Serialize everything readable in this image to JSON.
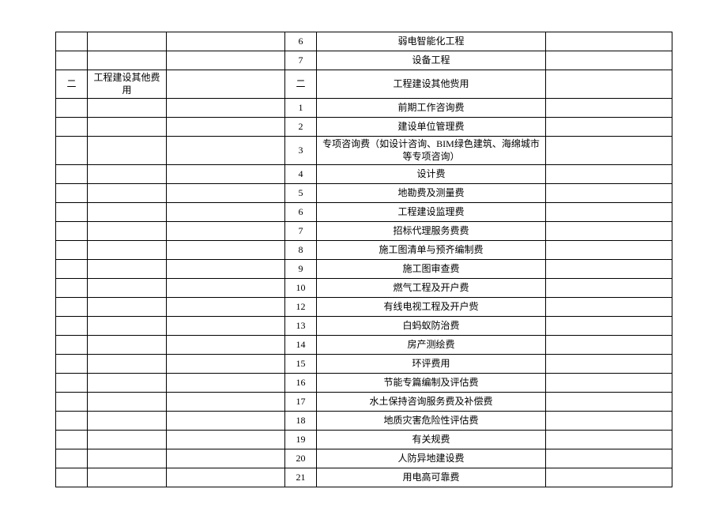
{
  "rows": [
    {
      "a": "",
      "b": "",
      "c": "",
      "d": "6",
      "e": "弱电智能化工程",
      "f": ""
    },
    {
      "a": "",
      "b": "",
      "c": "",
      "d": "7",
      "e": "设备工程",
      "f": ""
    },
    {
      "a": "二",
      "b": "工程建设其他费用",
      "c": "",
      "d": "二",
      "e": "工程建设其他赀用",
      "f": ""
    },
    {
      "a": "",
      "b": "",
      "c": "",
      "d": "1",
      "e": "前期工作咨询费",
      "f": ""
    },
    {
      "a": "",
      "b": "",
      "c": "",
      "d": "2",
      "e": "建设单位管理费",
      "f": ""
    },
    {
      "a": "",
      "b": "",
      "c": "",
      "d": "3",
      "e": "专项咨询费（如设计咨询、BIM绿色建筑、海绵城市等专项咨询）",
      "f": "",
      "tall": true
    },
    {
      "a": "",
      "b": "",
      "c": "",
      "d": "4",
      "e": "设计费",
      "f": ""
    },
    {
      "a": "",
      "b": "",
      "c": "",
      "d": "5",
      "e": "地勘费及测量费",
      "f": ""
    },
    {
      "a": "",
      "b": "",
      "c": "",
      "d": "6",
      "e": "工程建设监理费",
      "f": ""
    },
    {
      "a": "",
      "b": "",
      "c": "",
      "d": "7",
      "e": "招标代理服务费费",
      "f": ""
    },
    {
      "a": "",
      "b": "",
      "c": "",
      "d": "8",
      "e": "施工图清单与预齐编制费",
      "f": ""
    },
    {
      "a": "",
      "b": "",
      "c": "",
      "d": "9",
      "e": "施工图审查费",
      "f": ""
    },
    {
      "a": "",
      "b": "",
      "c": "",
      "d": "10",
      "e": "燃气工程及开户费",
      "f": ""
    },
    {
      "a": "",
      "b": "",
      "c": "",
      "d": "12",
      "e": "有线电视工程及开户赀",
      "f": ""
    },
    {
      "a": "",
      "b": "",
      "c": "",
      "d": "13",
      "e": "白蚂蚁防治费",
      "f": ""
    },
    {
      "a": "",
      "b": "",
      "c": "",
      "d": "14",
      "e": "房产测绘费",
      "f": ""
    },
    {
      "a": "",
      "b": "",
      "c": "",
      "d": "15",
      "e": "环评费用",
      "f": ""
    },
    {
      "a": "",
      "b": "",
      "c": "",
      "d": "16",
      "e": "节能专篇编制及评估费",
      "f": ""
    },
    {
      "a": "",
      "b": "",
      "c": "",
      "d": "17",
      "e": "水土保持咨询服务费及补偿费",
      "f": ""
    },
    {
      "a": "",
      "b": "",
      "c": "",
      "d": "18",
      "e": "地质灾害危险性评估费",
      "f": ""
    },
    {
      "a": "",
      "b": "",
      "c": "",
      "d": "19",
      "e": "有关规费",
      "f": ""
    },
    {
      "a": "",
      "b": "",
      "c": "",
      "d": "20",
      "e": "人防异地建设费",
      "f": ""
    },
    {
      "a": "",
      "b": "",
      "c": "",
      "d": "21",
      "e": "用电高可靠费",
      "f": ""
    }
  ]
}
